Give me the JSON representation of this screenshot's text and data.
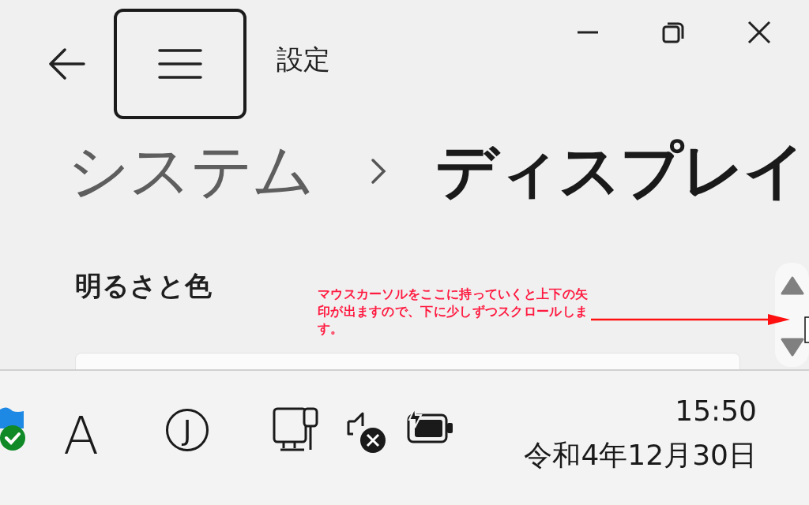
{
  "window": {
    "title": "設定"
  },
  "breadcrumb": [
    {
      "label": "システム",
      "selected": false
    },
    {
      "label": "ディスプレイ",
      "selected": true
    }
  ],
  "section": {
    "title": "明るさと色"
  },
  "annotation": {
    "text": "マウスカーソルをここに持っていくと上下の矢印が出ますので、下に少しずつスクロールします。"
  },
  "taskbar": {
    "ime_mode": "A",
    "ime_icon": "J",
    "time": "15:50",
    "date": "令和4年12月30日"
  }
}
